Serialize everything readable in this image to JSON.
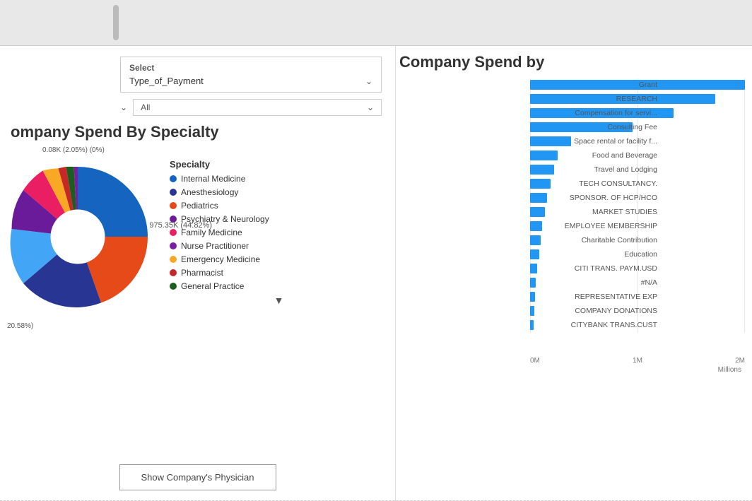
{
  "topBar": {
    "scrollIndicator": true
  },
  "leftPanel": {
    "selectBox": {
      "label": "Select",
      "value": "Type_of_Payment",
      "filterLabel": "All"
    },
    "chartTitle": "ompany Spend By Specialty",
    "pieLabels": {
      "top": "0.08K (2.05%) (0%)",
      "left": "%)",
      "bottom": "20.58%)",
      "center": "975.35K (44.82%)"
    },
    "legend": {
      "title": "Specialty",
      "items": [
        {
          "label": "Internal Medicine",
          "color": "#1565C0"
        },
        {
          "label": "Anesthesiology",
          "color": "#283593"
        },
        {
          "label": "Pediatrics",
          "color": "#E64A19"
        },
        {
          "label": "Psychiatry & Neurology",
          "color": "#6A1B9A"
        },
        {
          "label": "Family Medicine",
          "color": "#E91E63"
        },
        {
          "label": "Nurse Practitioner",
          "color": "#7B1FA2"
        },
        {
          "label": "Emergency Medicine",
          "color": "#F9A825"
        },
        {
          "label": "Pharmacist",
          "color": "#C62828"
        },
        {
          "label": "General Practice",
          "color": "#1B5E20"
        }
      ]
    },
    "showPhysicianBtn": "Show Company's Physician"
  },
  "rightPanel": {
    "title": "Company Spend by",
    "bars": [
      {
        "label": "Grant",
        "value": 320,
        "maxWidth": 310
      },
      {
        "label": "RESEARCH",
        "value": 270,
        "maxWidth": 310
      },
      {
        "label": "Compensation for servi...",
        "value": 210,
        "maxWidth": 310
      },
      {
        "label": "Consulting Fee",
        "value": 150,
        "maxWidth": 310
      },
      {
        "label": "Space rental or facility f...",
        "value": 60,
        "maxWidth": 310
      },
      {
        "label": "Food and Beverage",
        "value": 40,
        "maxWidth": 310
      },
      {
        "label": "Travel and Lodging",
        "value": 35,
        "maxWidth": 310
      },
      {
        "label": "TECH CONSULTANCY.",
        "value": 30,
        "maxWidth": 310
      },
      {
        "label": "SPONSOR. OF HCP/HCO",
        "value": 25,
        "maxWidth": 310
      },
      {
        "label": "MARKET STUDIES",
        "value": 22,
        "maxWidth": 310
      },
      {
        "label": "EMPLOYEE MEMBERSHIP",
        "value": 18,
        "maxWidth": 310
      },
      {
        "label": "Charitable Contribution",
        "value": 15,
        "maxWidth": 310
      },
      {
        "label": "Education",
        "value": 13,
        "maxWidth": 310
      },
      {
        "label": "CITI TRANS. PAYM.USD",
        "value": 10,
        "maxWidth": 310
      },
      {
        "label": "#N/A",
        "value": 8,
        "maxWidth": 310
      },
      {
        "label": "REPRESENTATIVE EXP",
        "value": 7,
        "maxWidth": 310
      },
      {
        "label": "COMPANY DONATIONS",
        "value": 6,
        "maxWidth": 310
      },
      {
        "label": "CITYBANK TRANS.CUST",
        "value": 5,
        "maxWidth": 310
      }
    ],
    "xAxisLabels": [
      "0M",
      "1M",
      "2M"
    ],
    "xAxisUnit": "Millions"
  }
}
